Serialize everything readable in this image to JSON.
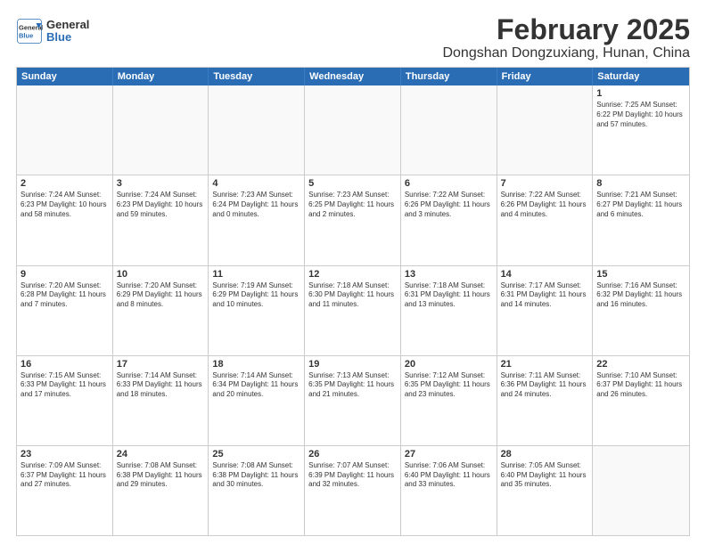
{
  "header": {
    "logo": {
      "line1": "General",
      "line2": "Blue"
    },
    "title": "February 2025",
    "subtitle": "Dongshan Dongzuxiang, Hunan, China"
  },
  "calendar": {
    "days_of_week": [
      "Sunday",
      "Monday",
      "Tuesday",
      "Wednesday",
      "Thursday",
      "Friday",
      "Saturday"
    ],
    "weeks": [
      [
        {
          "day": "",
          "info": ""
        },
        {
          "day": "",
          "info": ""
        },
        {
          "day": "",
          "info": ""
        },
        {
          "day": "",
          "info": ""
        },
        {
          "day": "",
          "info": ""
        },
        {
          "day": "",
          "info": ""
        },
        {
          "day": "1",
          "info": "Sunrise: 7:25 AM\nSunset: 6:22 PM\nDaylight: 10 hours and 57 minutes."
        }
      ],
      [
        {
          "day": "2",
          "info": "Sunrise: 7:24 AM\nSunset: 6:23 PM\nDaylight: 10 hours and 58 minutes."
        },
        {
          "day": "3",
          "info": "Sunrise: 7:24 AM\nSunset: 6:23 PM\nDaylight: 10 hours and 59 minutes."
        },
        {
          "day": "4",
          "info": "Sunrise: 7:23 AM\nSunset: 6:24 PM\nDaylight: 11 hours and 0 minutes."
        },
        {
          "day": "5",
          "info": "Sunrise: 7:23 AM\nSunset: 6:25 PM\nDaylight: 11 hours and 2 minutes."
        },
        {
          "day": "6",
          "info": "Sunrise: 7:22 AM\nSunset: 6:26 PM\nDaylight: 11 hours and 3 minutes."
        },
        {
          "day": "7",
          "info": "Sunrise: 7:22 AM\nSunset: 6:26 PM\nDaylight: 11 hours and 4 minutes."
        },
        {
          "day": "8",
          "info": "Sunrise: 7:21 AM\nSunset: 6:27 PM\nDaylight: 11 hours and 6 minutes."
        }
      ],
      [
        {
          "day": "9",
          "info": "Sunrise: 7:20 AM\nSunset: 6:28 PM\nDaylight: 11 hours and 7 minutes."
        },
        {
          "day": "10",
          "info": "Sunrise: 7:20 AM\nSunset: 6:29 PM\nDaylight: 11 hours and 8 minutes."
        },
        {
          "day": "11",
          "info": "Sunrise: 7:19 AM\nSunset: 6:29 PM\nDaylight: 11 hours and 10 minutes."
        },
        {
          "day": "12",
          "info": "Sunrise: 7:18 AM\nSunset: 6:30 PM\nDaylight: 11 hours and 11 minutes."
        },
        {
          "day": "13",
          "info": "Sunrise: 7:18 AM\nSunset: 6:31 PM\nDaylight: 11 hours and 13 minutes."
        },
        {
          "day": "14",
          "info": "Sunrise: 7:17 AM\nSunset: 6:31 PM\nDaylight: 11 hours and 14 minutes."
        },
        {
          "day": "15",
          "info": "Sunrise: 7:16 AM\nSunset: 6:32 PM\nDaylight: 11 hours and 16 minutes."
        }
      ],
      [
        {
          "day": "16",
          "info": "Sunrise: 7:15 AM\nSunset: 6:33 PM\nDaylight: 11 hours and 17 minutes."
        },
        {
          "day": "17",
          "info": "Sunrise: 7:14 AM\nSunset: 6:33 PM\nDaylight: 11 hours and 18 minutes."
        },
        {
          "day": "18",
          "info": "Sunrise: 7:14 AM\nSunset: 6:34 PM\nDaylight: 11 hours and 20 minutes."
        },
        {
          "day": "19",
          "info": "Sunrise: 7:13 AM\nSunset: 6:35 PM\nDaylight: 11 hours and 21 minutes."
        },
        {
          "day": "20",
          "info": "Sunrise: 7:12 AM\nSunset: 6:35 PM\nDaylight: 11 hours and 23 minutes."
        },
        {
          "day": "21",
          "info": "Sunrise: 7:11 AM\nSunset: 6:36 PM\nDaylight: 11 hours and 24 minutes."
        },
        {
          "day": "22",
          "info": "Sunrise: 7:10 AM\nSunset: 6:37 PM\nDaylight: 11 hours and 26 minutes."
        }
      ],
      [
        {
          "day": "23",
          "info": "Sunrise: 7:09 AM\nSunset: 6:37 PM\nDaylight: 11 hours and 27 minutes."
        },
        {
          "day": "24",
          "info": "Sunrise: 7:08 AM\nSunset: 6:38 PM\nDaylight: 11 hours and 29 minutes."
        },
        {
          "day": "25",
          "info": "Sunrise: 7:08 AM\nSunset: 6:38 PM\nDaylight: 11 hours and 30 minutes."
        },
        {
          "day": "26",
          "info": "Sunrise: 7:07 AM\nSunset: 6:39 PM\nDaylight: 11 hours and 32 minutes."
        },
        {
          "day": "27",
          "info": "Sunrise: 7:06 AM\nSunset: 6:40 PM\nDaylight: 11 hours and 33 minutes."
        },
        {
          "day": "28",
          "info": "Sunrise: 7:05 AM\nSunset: 6:40 PM\nDaylight: 11 hours and 35 minutes."
        },
        {
          "day": "",
          "info": ""
        }
      ]
    ]
  }
}
